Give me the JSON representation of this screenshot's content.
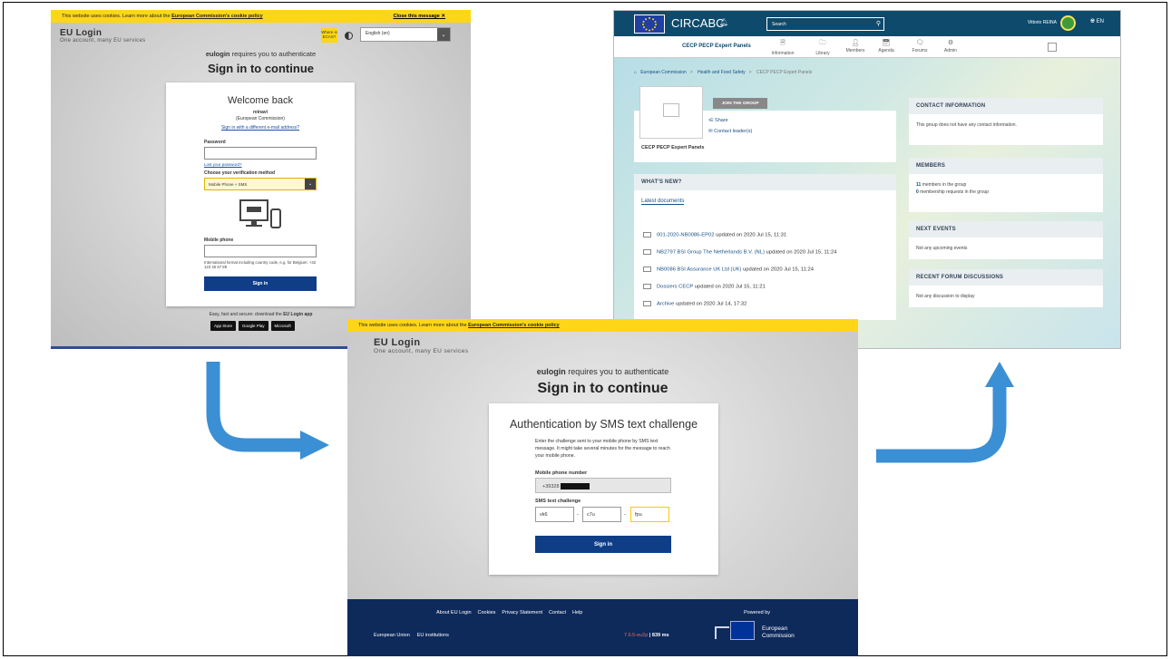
{
  "cookie": {
    "text": "This website uses cookies. Learn more about the",
    "link": "European Commission's cookie policy",
    "close": "Close this message"
  },
  "login1": {
    "brand_title": "EU Login",
    "brand_sub": "One account, many EU services",
    "ecas_badge": "Where is ECAS?",
    "language": "English (en)",
    "auth_app": "eulogin",
    "auth_rest": "requires you to authenticate",
    "sign_title": "Sign in to continue",
    "welcome": "Welcome back",
    "username": "reinavi",
    "org": "(European Commission)",
    "diff_email_link": "Sign in with a different e-mail address?",
    "password_label": "Password",
    "lost_password": "Lost your password?",
    "method_label": "Choose your verification method",
    "method_value": "Mobile Phone + SMS",
    "mobile_label": "Mobile phone",
    "mobile_hint": "International format including country code, e.g. for Belgium: +32 123 45 67 89",
    "sign_in": "Sign in",
    "app_line_pre": "Easy, fast and secure: download the",
    "app_line_bold": "EU Login app",
    "stores": [
      "App Store",
      "Google Play",
      "Microsoft"
    ]
  },
  "sms": {
    "brand_title": "EU Login",
    "brand_sub": "One account, many EU services",
    "auth_app": "eulogin",
    "auth_rest": "requires you to authenticate",
    "sign_title": "Sign in to continue",
    "card_title": "Authentication by SMS text challenge",
    "description": "Enter the challenge sent to your mobile phone by SMS text message. It might take several minutes for the message to reach your mobile phone.",
    "phone_label": "Mobile phone number",
    "phone_value": "+39328",
    "challenge_label": "SMS text challenge",
    "challenge": [
      "vk6",
      "c7u",
      "fpu"
    ],
    "sign_in": "Sign in",
    "footer_links": [
      "About EU Login",
      "Cookies",
      "Privacy Statement",
      "Contact",
      "Help"
    ],
    "footer_left": [
      "European Union",
      "EU institutions"
    ],
    "powered_by": "Powered by",
    "version": "7.6.5-eu2p",
    "timing": "| 839 ms",
    "ec_name_1": "European",
    "ec_name_2": "Commission"
  },
  "circabc": {
    "logo": "CIRCABC",
    "search_placeholder": "Search",
    "user": "Vittorio REINA",
    "lang": "EN",
    "group_name": "CECP PECP Expert Panels",
    "nav": [
      "Information",
      "Library",
      "Members",
      "Agenda",
      "Forums",
      "Admin"
    ],
    "breadcrumb": [
      "European Commission",
      "Health and Food Safety",
      "CECP PECP Expert Panels"
    ],
    "join_button": "JOIN THE GROUP",
    "share": "Share",
    "contact_leaders": "Contact leader(s)",
    "group_caption": "CECP PECP Expert Panels",
    "whats_new": "WHAT'S NEW?",
    "latest_docs": "Latest documents",
    "documents": [
      {
        "name": "001-2020-NB0086-EP02",
        "date": "updated on 2020 Jul 15, 11:31"
      },
      {
        "name": "NB2797 BSI Group The Netherlands B.V. (NL)",
        "date": "updated on 2020 Jul 15, 11:24"
      },
      {
        "name": "NB0086 BSI Assurance UK Ltd (UK)",
        "date": "updated on 2020 Jul 15, 11:24"
      },
      {
        "name": "Dossiers CECP",
        "date": "updated on 2020 Jul 15, 11:21"
      },
      {
        "name": "Archive",
        "date": "updated on 2020 Jul 14, 17:32"
      }
    ],
    "contact_head": "CONTACT INFORMATION",
    "contact_body": "This group does not have any contact information.",
    "members_head": "MEMBERS",
    "members_count": "11",
    "members_text": "members in the group",
    "requests_count": "0",
    "requests_text": "membership requests in the group",
    "events_head": "NEXT EVENTS",
    "events_body": "Not any upcoming events",
    "forum_head": "RECENT FORUM DISCUSSIONS",
    "forum_body": "Not any discussion to display"
  },
  "colors": {
    "arrow": "#3b8fd4",
    "eu_yellow": "#ffd617",
    "eu_blue": "#0f3e87",
    "circabc_dark": "#0e4a6b"
  }
}
